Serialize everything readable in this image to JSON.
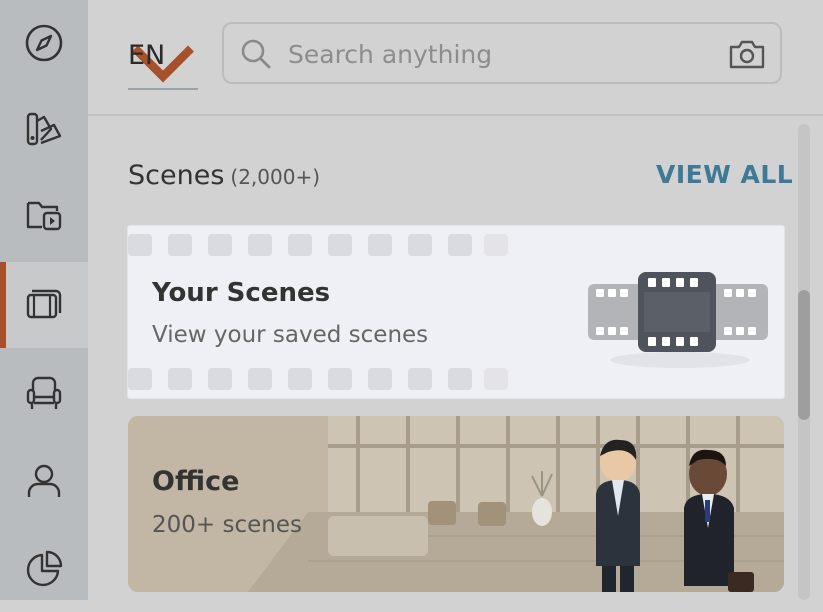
{
  "colors": {
    "rail_bg": "#b9bcbf",
    "accent": "#a7502c",
    "link": "#3e7a96"
  },
  "rail": {
    "items": [
      {
        "icon": "compass-icon",
        "active": false
      },
      {
        "icon": "palette-icon",
        "active": false
      },
      {
        "icon": "video-folder-icon",
        "active": false
      },
      {
        "icon": "scenes-icon",
        "active": true
      },
      {
        "icon": "chair-icon",
        "active": false
      },
      {
        "icon": "user-icon",
        "active": false
      },
      {
        "icon": "pie-chart-icon",
        "active": false
      }
    ]
  },
  "header": {
    "language": "EN",
    "search_placeholder": "Search anything"
  },
  "section": {
    "title": "Scenes",
    "count": "(2,000+)",
    "view_all": "VIEW ALL"
  },
  "cards": {
    "your_scenes": {
      "title": "Your Scenes",
      "subtitle": "View your saved scenes"
    },
    "office": {
      "title": "Office",
      "subtitle": "200+ scenes"
    }
  }
}
